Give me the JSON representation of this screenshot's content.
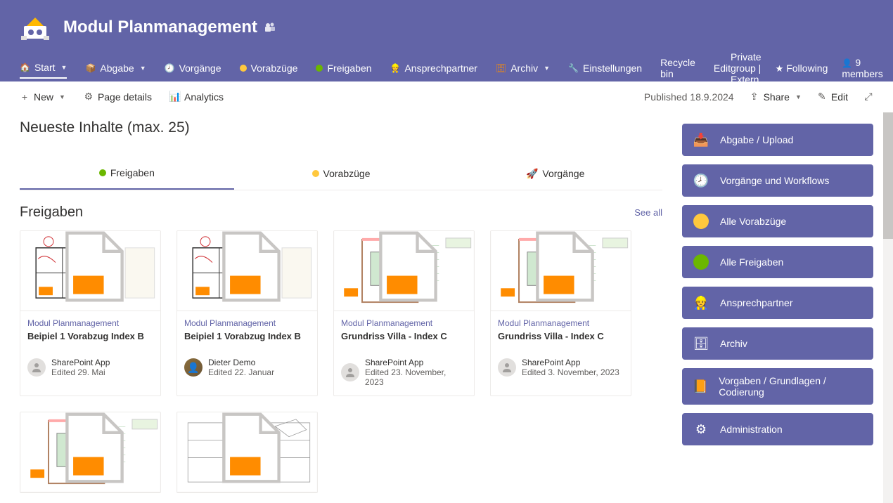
{
  "header": {
    "title": "Modul Planmanagement"
  },
  "nav": {
    "items": [
      {
        "label": "Start",
        "icon": "🏠",
        "active": true,
        "dropdown": true,
        "iconColor": "#f38b00"
      },
      {
        "label": "Abgabe",
        "icon": "📦",
        "dropdown": true,
        "iconColor": "#c2d91e"
      },
      {
        "label": "Vorgänge",
        "icon": "🕗",
        "iconColor": "#fff"
      },
      {
        "label": "Vorabzüge",
        "dot": "#ffc83d"
      },
      {
        "label": "Freigaben",
        "dot": "#6bb700"
      },
      {
        "label": "Ansprechpartner",
        "icon": "👷",
        "iconColor": "#ffb900"
      },
      {
        "label": "Archiv",
        "icon": "🗄",
        "dropdown": true,
        "iconColor": "#ff8c00"
      },
      {
        "label": "Einstellungen",
        "icon": "🔧",
        "iconColor": "#fff"
      },
      {
        "label": "Recycle bin"
      },
      {
        "label": "Edit"
      }
    ],
    "right": {
      "group": "Private group | Extern",
      "following": "Following",
      "members": "9 members"
    }
  },
  "cmdbar": {
    "left": [
      {
        "label": "New",
        "icon": "+",
        "dropdown": true
      },
      {
        "label": "Page details",
        "icon": "⚙"
      },
      {
        "label": "Analytics",
        "icon": "📊"
      }
    ],
    "right": {
      "published": "Published 18.9.2024",
      "share": "Share",
      "edit": "Edit"
    }
  },
  "section_title": "Neueste Inhalte (max. 25)",
  "tabs": [
    {
      "label": "Freigaben",
      "dot": "#6bb700",
      "active": true
    },
    {
      "label": "Vorabzüge",
      "dot": "#ffc83d"
    },
    {
      "label": "Vorgänge",
      "icon": "🚀"
    }
  ],
  "list": {
    "heading": "Freigaben",
    "see_all": "See all",
    "cards": [
      {
        "src": "Modul Planmanagement",
        "title": "Beipiel 1 Vorabzug Index B",
        "author": "SharePoint App",
        "date": "Edited 29. Mai",
        "avatar": "generic",
        "thumb": "floor"
      },
      {
        "src": "Modul Planmanagement",
        "title": "Beipiel 1 Vorabzug Index B",
        "author": "Dieter Demo",
        "date": "Edited 22. Januar",
        "avatar": "photo",
        "thumb": "floor"
      },
      {
        "src": "Modul Planmanagement",
        "title": "Grundriss Villa - Index C",
        "author": "SharePoint App",
        "date": "Edited 23. November, 2023",
        "avatar": "generic",
        "thumb": "room"
      },
      {
        "src": "Modul Planmanagement",
        "title": "Grundriss Villa - Index C",
        "author": "SharePoint App",
        "date": "Edited 3. November, 2023",
        "avatar": "generic",
        "thumb": "room"
      },
      {
        "thumb_only": true,
        "thumb": "room"
      },
      {
        "thumb_only": true,
        "thumb": "detail"
      }
    ]
  },
  "quicklinks": [
    {
      "label": "Abgabe / Upload",
      "icon": "📥"
    },
    {
      "label": "Vorgänge und Workflows",
      "icon": "🕗"
    },
    {
      "label": "Alle Vorabzüge",
      "dot": "#ffc83d"
    },
    {
      "label": "Alle Freigaben",
      "dot": "#6bb700"
    },
    {
      "label": "Ansprechpartner",
      "icon": "👷"
    },
    {
      "label": "Archiv",
      "icon": "🗄"
    },
    {
      "label": "Vorgaben / Grundlagen / Codierung",
      "icon": "📙"
    },
    {
      "label": "Administration",
      "icon": "⚙"
    }
  ]
}
